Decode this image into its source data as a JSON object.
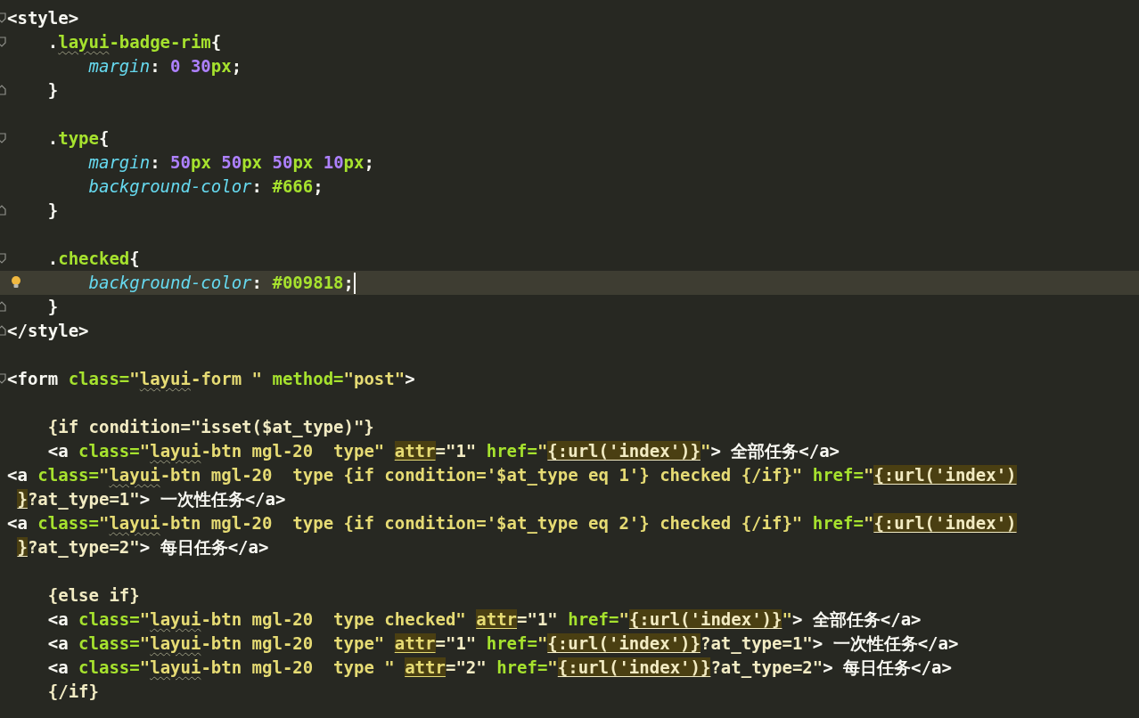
{
  "lines": [
    {
      "current": false,
      "kind": "open",
      "segments": [
        {
          "kind": "plain",
          "text": "<style>"
        }
      ]
    },
    {
      "current": false,
      "kind": "open",
      "segments": [
        {
          "kind": "plain",
          "text": "    ."
        },
        {
          "kind": "selector",
          "text": "layui",
          "spell": true
        },
        {
          "kind": "selector",
          "text": "-badge-rim"
        },
        {
          "kind": "plain",
          "text": "{"
        }
      ]
    },
    {
      "current": false,
      "kind": "plain",
      "segments": [
        {
          "kind": "prop",
          "text": "        margin"
        },
        {
          "kind": "plain",
          "text": ": "
        },
        {
          "kind": "number",
          "text": "0 30"
        },
        {
          "kind": "unit",
          "text": "px"
        },
        {
          "kind": "plain",
          "text": ";"
        }
      ]
    },
    {
      "current": false,
      "kind": "close",
      "segments": [
        {
          "kind": "plain",
          "text": "    }"
        }
      ]
    },
    {
      "current": false,
      "kind": "plain"
    },
    {
      "current": false,
      "kind": "open",
      "segments": [
        {
          "kind": "plain",
          "text": "    ."
        },
        {
          "kind": "selector",
          "text": "type"
        },
        {
          "kind": "plain",
          "text": "{"
        }
      ]
    },
    {
      "current": false,
      "kind": "plain",
      "segments": [
        {
          "kind": "prop",
          "text": "        margin"
        },
        {
          "kind": "plain",
          "text": ": "
        },
        {
          "kind": "number",
          "text": "50"
        },
        {
          "kind": "unit",
          "text": "px "
        },
        {
          "kind": "number",
          "text": "50"
        },
        {
          "kind": "unit",
          "text": "px "
        },
        {
          "kind": "number",
          "text": "50"
        },
        {
          "kind": "unit",
          "text": "px "
        },
        {
          "kind": "number",
          "text": "10"
        },
        {
          "kind": "unit",
          "text": "px"
        },
        {
          "kind": "plain",
          "text": ";"
        }
      ]
    },
    {
      "current": false,
      "kind": "plain",
      "segments": [
        {
          "kind": "prop",
          "text": "        background-color"
        },
        {
          "kind": "plain",
          "text": ": "
        },
        {
          "kind": "unit",
          "text": "#666"
        },
        {
          "kind": "plain",
          "text": ";"
        }
      ]
    },
    {
      "current": false,
      "kind": "close",
      "segments": [
        {
          "kind": "plain",
          "text": "    }"
        }
      ]
    },
    {
      "current": false,
      "kind": "plain"
    },
    {
      "current": false,
      "kind": "open",
      "segments": [
        {
          "kind": "plain",
          "text": "    ."
        },
        {
          "kind": "selector",
          "text": "checked"
        },
        {
          "kind": "plain",
          "text": "{"
        }
      ]
    },
    {
      "current": true,
      "kind": "plain",
      "segments": [
        {
          "kind": "prop",
          "text": "        background-color"
        },
        {
          "kind": "plain",
          "text": ": "
        },
        {
          "kind": "unit",
          "text": "#009818"
        },
        {
          "kind": "plain",
          "text": ";"
        }
      ]
    },
    {
      "current": false,
      "kind": "close",
      "segments": [
        {
          "kind": "plain",
          "text": "    }"
        }
      ]
    },
    {
      "current": false,
      "kind": "close",
      "segments": [
        {
          "kind": "plain",
          "text": "</style>"
        }
      ]
    },
    {
      "current": false,
      "kind": "plain"
    },
    {
      "current": false,
      "kind": "open",
      "segments": [
        {
          "kind": "plain",
          "text": "<form "
        },
        {
          "kind": "attr",
          "text": "class="
        },
        {
          "kind": "string",
          "text": "\""
        },
        {
          "kind": "string",
          "text": "layui",
          "spell": true
        },
        {
          "kind": "string",
          "text": "-form \" "
        },
        {
          "kind": "attr",
          "text": "method="
        },
        {
          "kind": "string",
          "text": "\"post\""
        },
        {
          "kind": "plain",
          "text": ">"
        }
      ]
    },
    {
      "current": false,
      "kind": "plain"
    },
    {
      "current": false,
      "kind": "plain",
      "segments": [
        {
          "kind": "template",
          "text": "    {if condition=\"isset($at_type)\"}"
        }
      ]
    },
    {
      "current": false,
      "kind": "plain",
      "segments": [
        {
          "kind": "plain",
          "text": "    <a "
        },
        {
          "kind": "attr",
          "text": "class="
        },
        {
          "kind": "string",
          "text": "\""
        },
        {
          "kind": "string",
          "text": "layui",
          "spell": true
        },
        {
          "kind": "string",
          "text": "-btn mgl-20  type\" "
        },
        {
          "kind": "string",
          "text": "attr",
          "mark": true
        },
        {
          "kind": "template",
          "text": "=\"1\" "
        },
        {
          "kind": "attr",
          "text": "href="
        },
        {
          "kind": "string",
          "text": "\""
        },
        {
          "kind": "template",
          "text": "{:url('index')}",
          "mark": true
        },
        {
          "kind": "string",
          "text": "\""
        },
        {
          "kind": "plain",
          "text": "> 全部任务</a>"
        }
      ]
    },
    {
      "current": false,
      "kind": "plain",
      "segments": [
        {
          "kind": "plain",
          "text": "<a "
        },
        {
          "kind": "attr",
          "text": "class="
        },
        {
          "kind": "string",
          "text": "\""
        },
        {
          "kind": "string",
          "text": "layui",
          "spell": true
        },
        {
          "kind": "string",
          "text": "-btn mgl-20  type {if condition='$at_type eq 1'} checked {/if}\" "
        },
        {
          "kind": "attr",
          "text": "href="
        },
        {
          "kind": "string",
          "text": "\""
        },
        {
          "kind": "template",
          "text": "{:url('index')",
          "mark": true
        }
      ]
    },
    {
      "current": false,
      "kind": "plain",
      "segments": [
        {
          "kind": "template",
          "text": " }",
          "mark": true
        },
        {
          "kind": "template",
          "text": "?at_type=1\""
        },
        {
          "kind": "plain",
          "text": "> 一次性任务</a>"
        }
      ]
    },
    {
      "current": false,
      "kind": "plain",
      "segments": [
        {
          "kind": "plain",
          "text": "<a "
        },
        {
          "kind": "attr",
          "text": "class="
        },
        {
          "kind": "string",
          "text": "\""
        },
        {
          "kind": "string",
          "text": "layui",
          "spell": true
        },
        {
          "kind": "string",
          "text": "-btn mgl-20  type {if condition='$at_type eq 2'} checked {/if}\" "
        },
        {
          "kind": "attr",
          "text": "href="
        },
        {
          "kind": "string",
          "text": "\""
        },
        {
          "kind": "template",
          "text": "{:url('index')",
          "mark": true
        }
      ]
    },
    {
      "current": false,
      "kind": "plain",
      "segments": [
        {
          "kind": "template",
          "text": " }",
          "mark": true
        },
        {
          "kind": "template",
          "text": "?at_type=2\""
        },
        {
          "kind": "plain",
          "text": "> 每日任务</a>"
        }
      ]
    },
    {
      "current": false,
      "kind": "plain"
    },
    {
      "current": false,
      "kind": "plain",
      "segments": [
        {
          "kind": "template",
          "text": "    {else if}"
        }
      ]
    },
    {
      "current": false,
      "kind": "plain",
      "segments": [
        {
          "kind": "plain",
          "text": "    <a "
        },
        {
          "kind": "attr",
          "text": "class="
        },
        {
          "kind": "string",
          "text": "\""
        },
        {
          "kind": "string",
          "text": "layui",
          "spell": true
        },
        {
          "kind": "string",
          "text": "-btn mgl-20  type checked\" "
        },
        {
          "kind": "string",
          "text": "attr",
          "mark": true
        },
        {
          "kind": "template",
          "text": "=\"1\" "
        },
        {
          "kind": "attr",
          "text": "href="
        },
        {
          "kind": "string",
          "text": "\""
        },
        {
          "kind": "template",
          "text": "{:url('index')}",
          "mark": true
        },
        {
          "kind": "string",
          "text": "\""
        },
        {
          "kind": "plain",
          "text": "> 全部任务</a>"
        }
      ]
    },
    {
      "current": false,
      "kind": "plain",
      "segments": [
        {
          "kind": "plain",
          "text": "    <a "
        },
        {
          "kind": "attr",
          "text": "class="
        },
        {
          "kind": "string",
          "text": "\""
        },
        {
          "kind": "string",
          "text": "layui",
          "spell": true
        },
        {
          "kind": "string",
          "text": "-btn mgl-20  type\" "
        },
        {
          "kind": "string",
          "text": "attr",
          "mark": true
        },
        {
          "kind": "template",
          "text": "=\"1\" "
        },
        {
          "kind": "attr",
          "text": "href="
        },
        {
          "kind": "string",
          "text": "\""
        },
        {
          "kind": "template",
          "text": "{:url('index')}",
          "mark": true
        },
        {
          "kind": "template",
          "text": "?at_type=1\""
        },
        {
          "kind": "plain",
          "text": "> 一次性任务</a>"
        }
      ]
    },
    {
      "current": false,
      "kind": "plain",
      "segments": [
        {
          "kind": "plain",
          "text": "    <a "
        },
        {
          "kind": "attr",
          "text": "class="
        },
        {
          "kind": "string",
          "text": "\""
        },
        {
          "kind": "string",
          "text": "layui",
          "spell": true
        },
        {
          "kind": "string",
          "text": "-btn mgl-20  type \" "
        },
        {
          "kind": "string",
          "text": "attr",
          "mark": true
        },
        {
          "kind": "template",
          "text": "=\"2\" "
        },
        {
          "kind": "attr",
          "text": "href="
        },
        {
          "kind": "string",
          "text": "\""
        },
        {
          "kind": "template",
          "text": "{:url('index')}",
          "mark": true
        },
        {
          "kind": "template",
          "text": "?at_type=2\""
        },
        {
          "kind": "plain",
          "text": "> 每日任务</a>"
        }
      ]
    },
    {
      "current": false,
      "kind": "plain",
      "segments": [
        {
          "kind": "template",
          "text": "    {/if}"
        }
      ]
    }
  ]
}
